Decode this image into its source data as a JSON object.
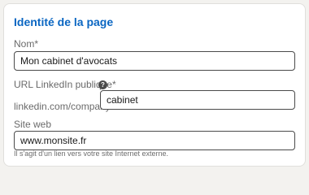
{
  "section": {
    "title": "Identité de la page"
  },
  "name_field": {
    "label": "Nom*",
    "value": "Mon cabinet d'avocats"
  },
  "linkedin_field": {
    "label": "URL LinkedIn publique*",
    "help_icon": "question-circle-icon",
    "prefix": "linkedin.com/company/",
    "value": "cabinet"
  },
  "website_field": {
    "label": "Site web",
    "value": "www.monsite.fr",
    "hint": "Il s'agit d'un lien vers votre site Internet externe."
  },
  "colors": {
    "accent": "#0a66c2",
    "background": "#f3f2ef",
    "card": "#ffffff"
  }
}
